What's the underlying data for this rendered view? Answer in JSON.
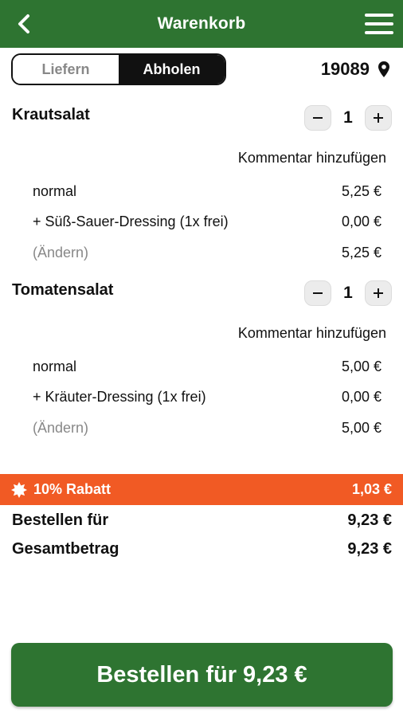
{
  "colors": {
    "brand_green": "#2e7431",
    "discount_orange": "#f15a24",
    "muted_gray": "#888888"
  },
  "header": {
    "title": "Warenkorb",
    "back_icon": "chevron-left-icon",
    "menu_icon": "hamburger-menu-icon"
  },
  "delivery_mode": {
    "options": [
      "Liefern",
      "Abholen"
    ],
    "selected": "Abholen"
  },
  "location": {
    "postal_code": "19089",
    "icon": "map-pin-icon"
  },
  "items": [
    {
      "name": "Krautsalat",
      "quantity": "1",
      "comment_label": "Kommentar hinzufügen",
      "lines": [
        {
          "label": "normal",
          "price": "5,25 €"
        },
        {
          "label": "+ Süß-Sauer-Dressing (1x frei)",
          "price": "0,00 €"
        },
        {
          "label": "(Ändern)",
          "price": "5,25 €"
        }
      ]
    },
    {
      "name": "Tomatensalat",
      "quantity": "1",
      "comment_label": "Kommentar hinzufügen",
      "lines": [
        {
          "label": "normal",
          "price": "5,00 €"
        },
        {
          "label": "+ Kräuter-Dressing (1x frei)",
          "price": "0,00 €"
        },
        {
          "label": "(Ändern)",
          "price": "5,00 €"
        }
      ]
    }
  ],
  "discount": {
    "label": "10% Rabatt",
    "amount": "1,03 €",
    "icon": "badge-icon"
  },
  "summary": {
    "order_for_label": "Bestellen für",
    "order_for_value": "9,23 €",
    "total_label": "Gesamtbetrag",
    "total_value": "9,23 €"
  },
  "order_button": {
    "label": "Bestellen für 9,23 €"
  }
}
